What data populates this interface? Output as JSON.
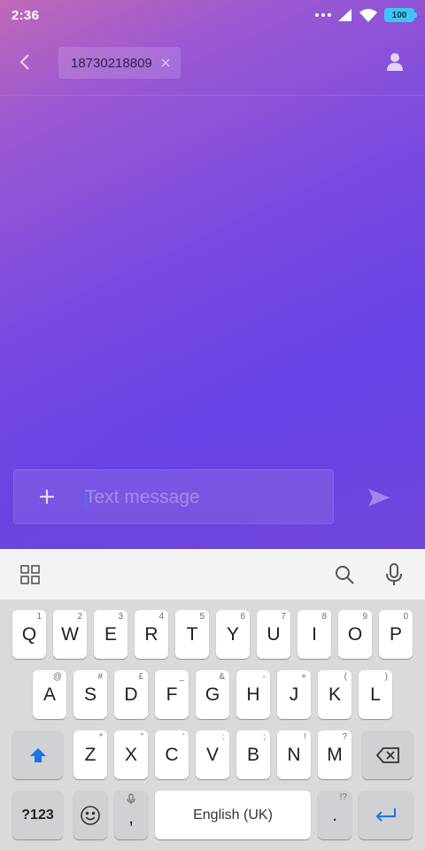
{
  "status_bar": {
    "time": "2:36",
    "battery": "100"
  },
  "header": {
    "recipient": "18730218809",
    "icons": [
      "back-arrow-icon",
      "close-icon",
      "contact-icon"
    ]
  },
  "composer": {
    "placeholder": "Text message",
    "value": "",
    "icons": [
      "plus-icon",
      "send-icon"
    ]
  },
  "keyboard_toolbar": {
    "icons": [
      "apps-grid-icon",
      "search-icon",
      "microphone-icon"
    ]
  },
  "keyboard": {
    "row1": [
      {
        "label": "Q",
        "hint": "1"
      },
      {
        "label": "W",
        "hint": "2"
      },
      {
        "label": "E",
        "hint": "3"
      },
      {
        "label": "R",
        "hint": "4"
      },
      {
        "label": "T",
        "hint": "5"
      },
      {
        "label": "Y",
        "hint": "6"
      },
      {
        "label": "U",
        "hint": "7"
      },
      {
        "label": "I",
        "hint": "8"
      },
      {
        "label": "O",
        "hint": "9"
      },
      {
        "label": "P",
        "hint": "0"
      }
    ],
    "row2": [
      {
        "label": "A",
        "hint": "@"
      },
      {
        "label": "S",
        "hint": "#"
      },
      {
        "label": "D",
        "hint": "£"
      },
      {
        "label": "F",
        "hint": "_"
      },
      {
        "label": "G",
        "hint": "&"
      },
      {
        "label": "H",
        "hint": "-"
      },
      {
        "label": "J",
        "hint": "+"
      },
      {
        "label": "K",
        "hint": "("
      },
      {
        "label": "L",
        "hint": ")"
      }
    ],
    "row3": [
      {
        "label": "Z",
        "hint": "*"
      },
      {
        "label": "X",
        "hint": "\""
      },
      {
        "label": "C",
        "hint": "'"
      },
      {
        "label": "V",
        "hint": ":"
      },
      {
        "label": "B",
        "hint": ";"
      },
      {
        "label": "N",
        "hint": "!"
      },
      {
        "label": "M",
        "hint": "?"
      }
    ],
    "symbols_key": "?123",
    "comma_key": ",",
    "space_key": "English (UK)",
    "period_key": ".",
    "period_hint": "!?",
    "accent_color": "#1a73e8"
  }
}
